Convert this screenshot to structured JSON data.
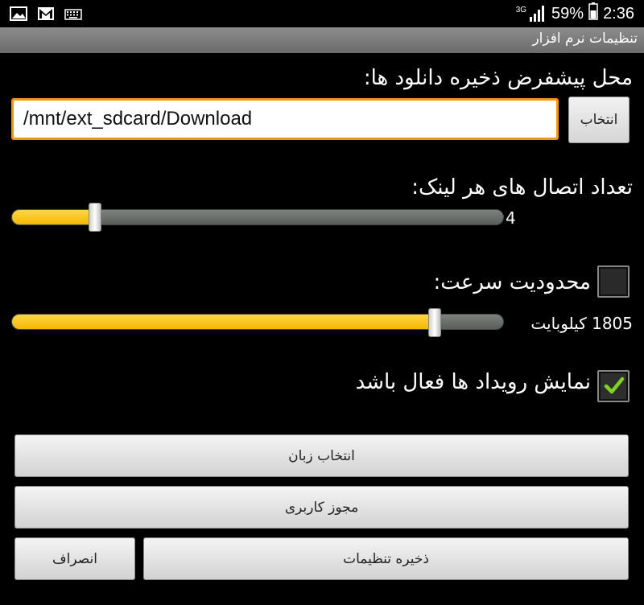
{
  "status_bar": {
    "network": "3G",
    "battery_percent": "59%",
    "time": "2:36",
    "left_icons": [
      "gallery-icon",
      "gmail-icon",
      "keyboard-icon"
    ]
  },
  "app_bar": {
    "title": "تنظیمات نرم افزار"
  },
  "download_location": {
    "label": "محل پیشفرض ذخیره دانلود ها:",
    "path_value": "/mnt/ext_sdcard/Download",
    "browse_label": "انتخاب"
  },
  "connections": {
    "label": "تعداد اتصال های هر لینک:",
    "value_text": "4",
    "level_fraction": 0.17
  },
  "speed_limit": {
    "label": "محدودیت سرعت:",
    "checked": false,
    "value_text": "1805 کیلوبایت",
    "level_fraction": 0.86
  },
  "show_events": {
    "label": "نمایش رویداد ها فعال باشد",
    "checked": true
  },
  "buttons": {
    "language": "انتخاب زبان",
    "license": "مجوز کاربری",
    "save": "ذخیره تنظیمات",
    "cancel": "انصراف"
  },
  "colors": {
    "accent_orange": "#f0960f",
    "slider_fill": "#f5b800",
    "check_green": "#7ed321"
  }
}
